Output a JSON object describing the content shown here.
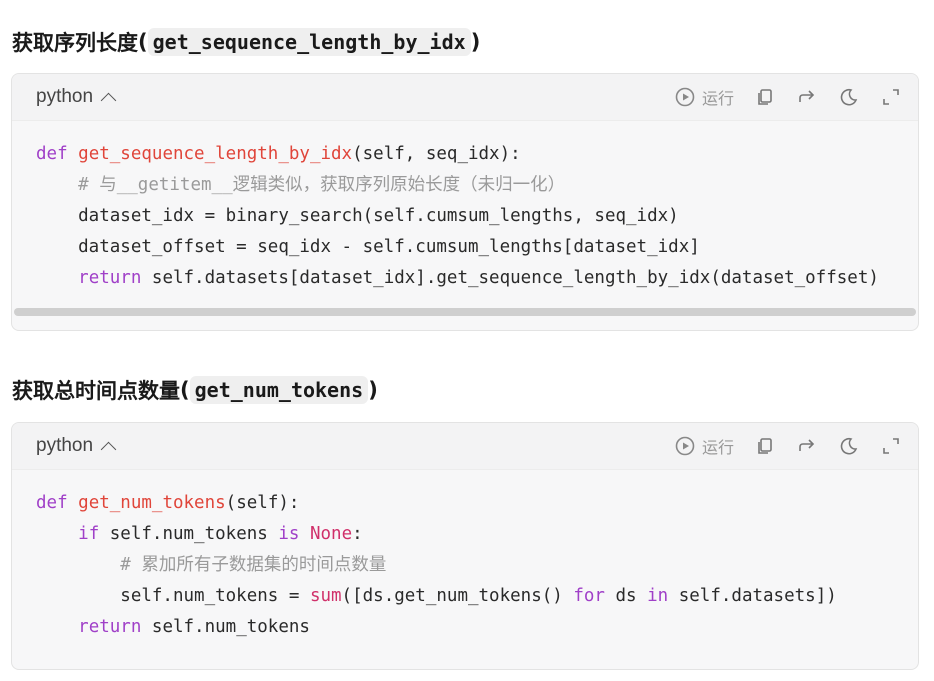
{
  "sections": [
    {
      "title_prefix": "获取序列长度",
      "title_code": "get_sequence_length_by_idx",
      "open_paren": "(",
      "close_paren": ")",
      "lang": "python",
      "run_label": "运行",
      "lines": [
        [
          {
            "t": "def ",
            "c": "kw"
          },
          {
            "t": "get_sequence_length_by_idx",
            "c": "fn"
          },
          {
            "t": "(self, seq_idx):",
            "c": ""
          }
        ],
        [
          {
            "t": "    # 与__getitem__逻辑类似，获取序列原始长度（未归一化）",
            "c": "cm"
          }
        ],
        [
          {
            "t": "    dataset_idx = binary_search(self.cumsum_lengths, seq_idx)",
            "c": ""
          }
        ],
        [
          {
            "t": "    dataset_offset = seq_idx - self.cumsum_lengths[dataset_idx]",
            "c": ""
          }
        ],
        [
          {
            "t": "    ",
            "c": ""
          },
          {
            "t": "return",
            "c": "kw"
          },
          {
            "t": " self.datasets[dataset_idx].get_sequence_length_by_idx(dataset_offset)",
            "c": ""
          }
        ]
      ]
    },
    {
      "title_prefix": "获取总时间点数量",
      "title_code": "get_num_tokens",
      "open_paren": "(",
      "close_paren": ")",
      "lang": "python",
      "run_label": "运行",
      "lines": [
        [
          {
            "t": "def ",
            "c": "kw"
          },
          {
            "t": "get_num_tokens",
            "c": "fn"
          },
          {
            "t": "(self):",
            "c": ""
          }
        ],
        [
          {
            "t": "    ",
            "c": ""
          },
          {
            "t": "if",
            "c": "kw"
          },
          {
            "t": " self.num_tokens ",
            "c": ""
          },
          {
            "t": "is",
            "c": "kw"
          },
          {
            "t": " ",
            "c": ""
          },
          {
            "t": "None",
            "c": "bi"
          },
          {
            "t": ":",
            "c": ""
          }
        ],
        [
          {
            "t": "        # 累加所有子数据集的时间点数量",
            "c": "cm"
          }
        ],
        [
          {
            "t": "        self.num_tokens = ",
            "c": ""
          },
          {
            "t": "sum",
            "c": "bi"
          },
          {
            "t": "([ds.get_num_tokens() ",
            "c": ""
          },
          {
            "t": "for",
            "c": "kw"
          },
          {
            "t": " ds ",
            "c": ""
          },
          {
            "t": "in",
            "c": "kw"
          },
          {
            "t": " self.datasets])",
            "c": ""
          }
        ],
        [
          {
            "t": "    ",
            "c": ""
          },
          {
            "t": "return",
            "c": "kw"
          },
          {
            "t": " self.num_tokens",
            "c": ""
          }
        ]
      ]
    }
  ],
  "icons": [
    "play-circle-icon",
    "copy-icon",
    "redo-icon",
    "moon-icon",
    "expand-icon"
  ]
}
